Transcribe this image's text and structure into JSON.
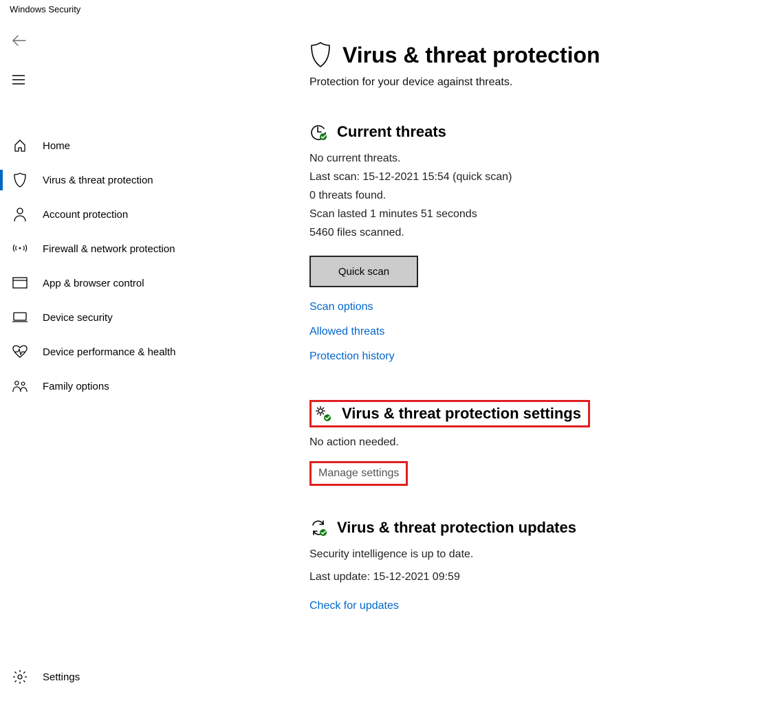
{
  "window_title": "Windows Security",
  "sidebar": {
    "items": [
      {
        "label": "Home"
      },
      {
        "label": "Virus & threat protection"
      },
      {
        "label": "Account protection"
      },
      {
        "label": "Firewall & network protection"
      },
      {
        "label": "App & browser control"
      },
      {
        "label": "Device security"
      },
      {
        "label": "Device performance & health"
      },
      {
        "label": "Family options"
      }
    ],
    "settings_label": "Settings"
  },
  "page": {
    "title": "Virus & threat protection",
    "subtitle": "Protection for your device against threats."
  },
  "current_threats": {
    "title": "Current threats",
    "no_threats": "No current threats.",
    "last_scan": "Last scan: 15-12-2021 15:54 (quick scan)",
    "threats_found": "0 threats found.",
    "duration": "Scan lasted 1 minutes 51 seconds",
    "files_scanned": "5460 files scanned.",
    "quick_scan_label": "Quick scan",
    "scan_options_link": "Scan options",
    "allowed_threats_link": "Allowed threats",
    "protection_history_link": "Protection history"
  },
  "vtp_settings": {
    "title": "Virus & threat protection settings",
    "status": "No action needed.",
    "manage_link": "Manage settings"
  },
  "vtp_updates": {
    "title": "Virus & threat protection updates",
    "status": "Security intelligence is up to date.",
    "last_update": "Last update: 15-12-2021 09:59",
    "check_link": "Check for updates"
  }
}
